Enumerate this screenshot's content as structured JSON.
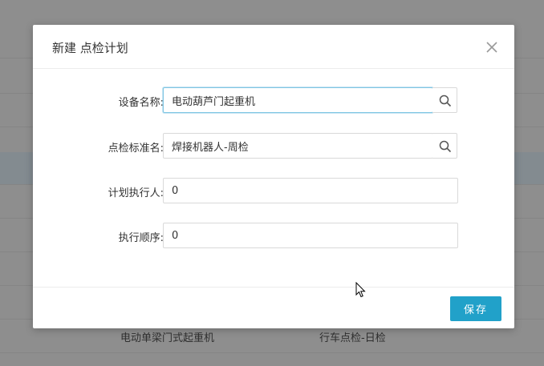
{
  "background": {
    "rows": [
      {
        "equipment": "电动单梁门式起重机",
        "standard": "行车点检-日检"
      }
    ]
  },
  "modal": {
    "title": "新建 点检计划",
    "fields": [
      {
        "label": "设备名称:",
        "value": "电动葫芦门起重机",
        "has_search": true,
        "focused": true
      },
      {
        "label": "点检标准名:",
        "value": "焊接机器人-周检",
        "has_search": true,
        "focused": false
      },
      {
        "label": "计划执行人:",
        "value": "0",
        "has_search": false,
        "focused": false
      },
      {
        "label": "执行顺序:",
        "value": "0",
        "has_search": false,
        "focused": false
      }
    ],
    "save_label": "保存"
  },
  "colors": {
    "primary": "#21a1c9",
    "overlay": "#8e8e8e",
    "focus_border": "#7fc6e3"
  },
  "icons": [
    "close-icon",
    "search-icon",
    "mouse-cursor-icon"
  ]
}
